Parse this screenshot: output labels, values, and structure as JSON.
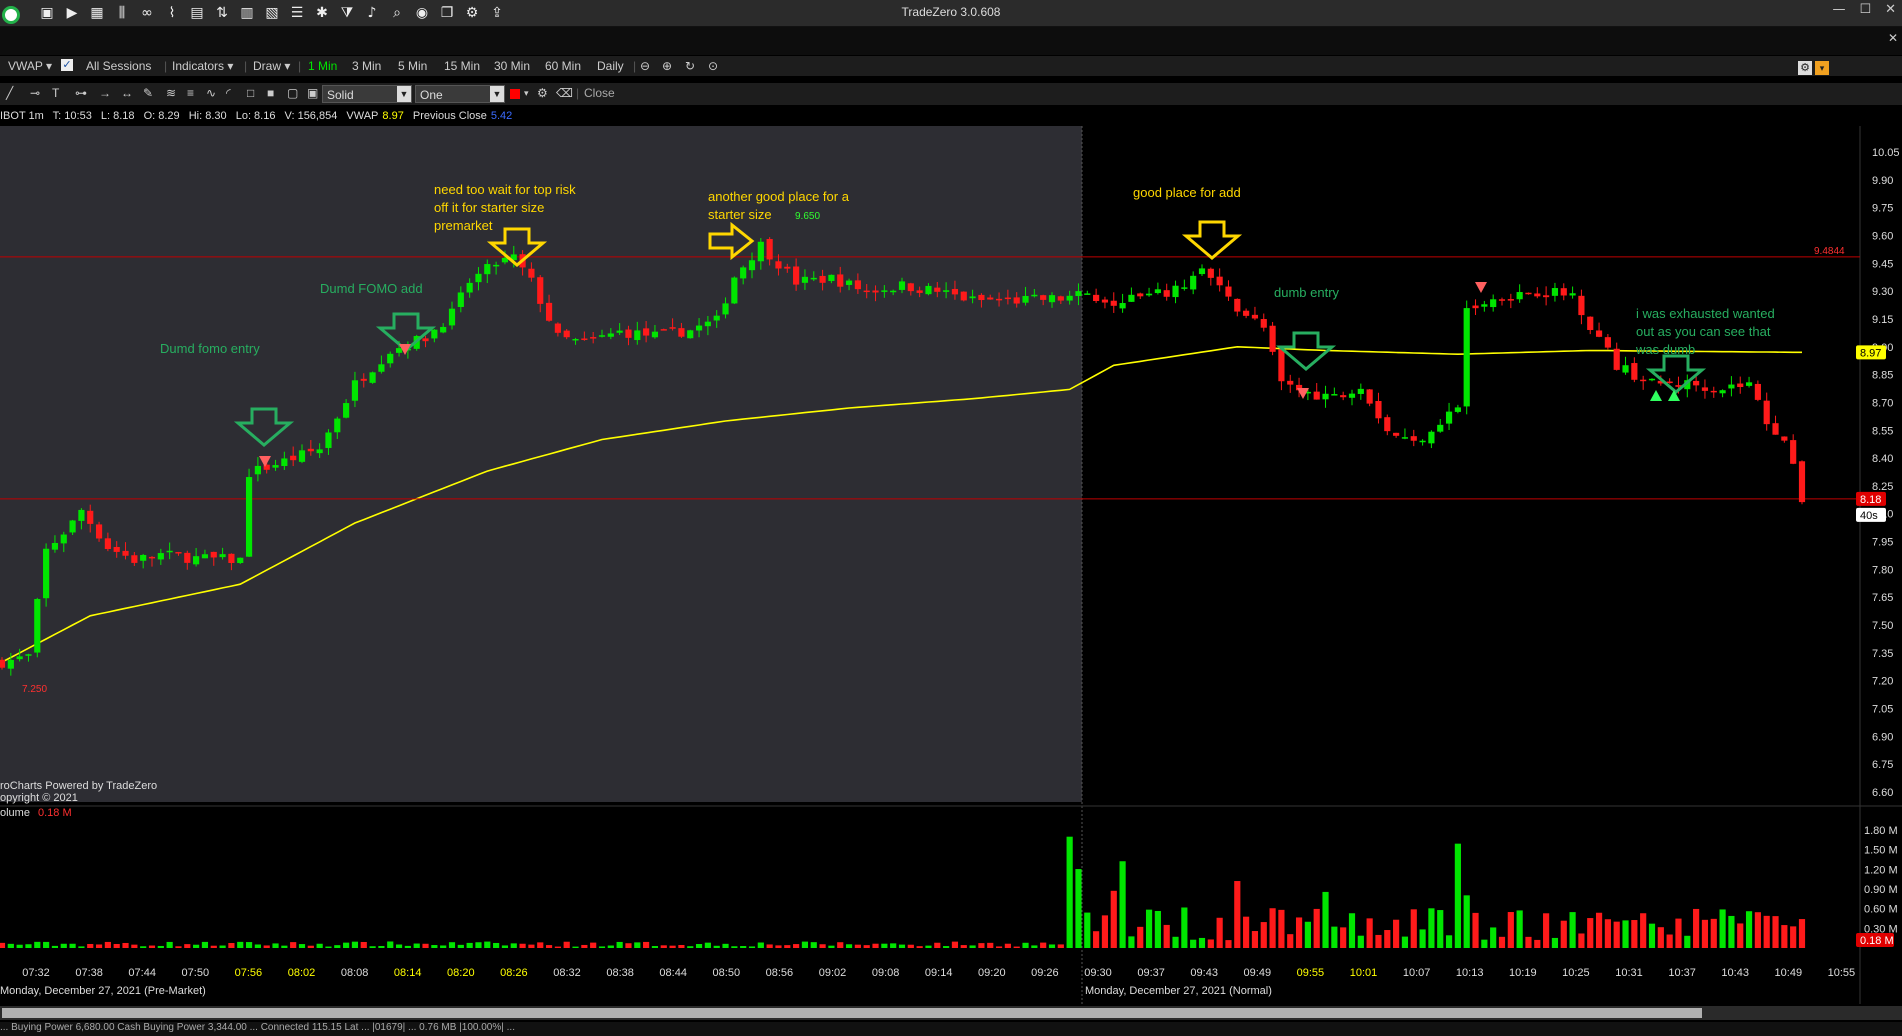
{
  "app": {
    "title": "TradeZero 3.0.608"
  },
  "toolbar_icons": [
    "camera-icon",
    "play-icon",
    "table-icon",
    "bars-icon",
    "link-icon",
    "chart-line-icon",
    "document-icon",
    "arrows-icon",
    "grid-icon",
    "news-icon",
    "list-icon",
    "tools-icon",
    "filter-icon",
    "bell-icon",
    "search-icon",
    "globe-icon",
    "windows-icon",
    "gear-icon",
    "export-icon"
  ],
  "menu": {
    "vwap": "VWAP",
    "all_sessions": "All Sessions",
    "indicators": "Indicators",
    "draw": "Draw",
    "timeframes": [
      "1 Min",
      "3 Min",
      "5 Min",
      "15 Min",
      "30 Min",
      "60 Min",
      "Daily"
    ],
    "active_timeframe": "1 Min"
  },
  "drawbar": {
    "line_style": "Solid",
    "line_width": "One",
    "close": "Close"
  },
  "info": {
    "symbol": "IBOT 1m",
    "time": "T: 10:53",
    "last": "L: 8.18",
    "open": "O: 8.29",
    "high": "Hi: 8.30",
    "low": "Lo: 8.16",
    "volume": "V: 156,854",
    "vwap_label": "VWAP",
    "vwap_value": "8.97",
    "prev_close_label": "Previous Close",
    "prev_close_value": "5.42"
  },
  "colors": {
    "up": "#00e600",
    "down": "#ff1a1a",
    "vwap": "#ffff00",
    "premarket_bg": "#2d2d33",
    "regular_bg": "#000000",
    "annotation_green": "#27ae60",
    "annotation_yellow": "#ffd700"
  },
  "watermark": {
    "line1": "roCharts Powered by TradeZero",
    "line2": "opyright © 2021"
  },
  "volume_label": "olume",
  "volume_value": "0.18 M",
  "session_labels": {
    "pre": "Monday, December 27, 2021 (Pre-Market)",
    "normal": "Monday, December 27, 2021 (Normal)"
  },
  "annotations": {
    "fomo_entry": "Dumd fomo entry",
    "fomo_add": "Dumd FOMO add",
    "wait_top_1": "need too wait for top risk",
    "wait_top_2": "off it for starter size",
    "wait_top_3": "premarket",
    "another_good_1": "another good place for a",
    "another_good_2": "starter size",
    "good_add": "good place for add",
    "dumb_entry": "dumb entry",
    "exhausted_1": "i was exhausted wanted",
    "exhausted_2": "out as you can see that",
    "exhausted_3": "was dumb"
  },
  "price_markers": {
    "low_marker": "7.250",
    "high_marker": "9.650",
    "hline_label": "9.4844",
    "vwap_tag": "8.97",
    "last_tag": "8.18",
    "timer_tag": "40s"
  },
  "status_text": "... Buying Power 6,680.00  Cash Buying Power 3,344.00  ...  Connected  115.15 Lat  ...  |01679|  ...  0.76 MB  |100.00%|  ...",
  "chart_data": {
    "type": "candlestick",
    "y_axis_ticks": [
      "10.05",
      "9.90",
      "9.75",
      "9.60",
      "9.45",
      "9.30",
      "9.15",
      "9.00",
      "8.85",
      "8.70",
      "8.55",
      "8.40",
      "8.25",
      "8.10",
      "7.95",
      "7.80",
      "7.65",
      "7.50",
      "7.35",
      "7.20",
      "7.05",
      "6.90",
      "6.75",
      "6.60"
    ],
    "ylim": [
      6.6,
      10.05
    ],
    "volume_ticks": [
      "1.80 M",
      "1.50 M",
      "1.20 M",
      "0.90 M",
      "0.60 M",
      "0.30 M"
    ],
    "volume_max": 1.8,
    "x_ticks": [
      "07:32",
      "07:38",
      "07:44",
      "07:50",
      "07:56",
      "08:02",
      "08:08",
      "08:14",
      "08:20",
      "08:26",
      "08:32",
      "08:38",
      "08:44",
      "08:50",
      "08:56",
      "09:02",
      "09:08",
      "09:14",
      "09:20",
      "09:26",
      "09:30",
      "09:37",
      "09:43",
      "09:49",
      "09:55",
      "10:01",
      "10:07",
      "10:13",
      "10:19",
      "10:25",
      "10:31",
      "10:37",
      "10:43",
      "10:49",
      "10:55"
    ],
    "highlighted_ticks": [
      "07:56",
      "08:02",
      "08:14",
      "08:20",
      "08:26",
      "09:55",
      "10:01"
    ],
    "horizontal_lines": [
      9.4844,
      8.18
    ],
    "series": [
      {
        "name": "price",
        "path": [
          [
            0,
            7.3
          ],
          [
            3,
            7.33
          ],
          [
            5,
            7.9
          ],
          [
            8,
            8.05
          ],
          [
            9,
            8.12
          ],
          [
            12,
            7.92
          ],
          [
            15,
            7.85
          ],
          [
            18,
            7.88
          ],
          [
            22,
            7.86
          ],
          [
            27,
            7.85
          ],
          [
            28,
            8.32
          ],
          [
            33,
            8.4
          ],
          [
            36,
            8.45
          ],
          [
            40,
            8.8
          ],
          [
            44,
            8.98
          ],
          [
            48,
            9.05
          ],
          [
            51,
            9.18
          ],
          [
            53,
            9.35
          ],
          [
            56,
            9.45
          ],
          [
            58,
            9.48
          ],
          [
            60,
            9.35
          ],
          [
            63,
            9.05
          ],
          [
            66,
            9.02
          ],
          [
            70,
            9.08
          ],
          [
            74,
            9.06
          ],
          [
            78,
            9.09
          ],
          [
            81,
            9.14
          ],
          [
            83,
            9.38
          ],
          [
            86,
            9.55
          ],
          [
            88,
            9.45
          ],
          [
            90,
            9.35
          ],
          [
            94,
            9.37
          ],
          [
            98,
            9.3
          ],
          [
            102,
            9.33
          ],
          [
            106,
            9.3
          ],
          [
            110,
            9.25
          ],
          [
            115,
            9.25
          ],
          [
            120,
            9.26
          ],
          [
            123,
            9.28
          ],
          [
            126,
            9.25
          ],
          [
            130,
            9.27
          ],
          [
            133,
            9.3
          ],
          [
            136,
            9.42
          ],
          [
            139,
            9.25
          ],
          [
            143,
            9.1
          ],
          [
            145,
            8.8
          ],
          [
            148,
            8.75
          ],
          [
            151,
            8.73
          ],
          [
            154,
            8.8
          ],
          [
            157,
            8.55
          ],
          [
            160,
            8.48
          ],
          [
            163,
            8.6
          ],
          [
            165,
            8.68
          ],
          [
            166,
            9.2
          ],
          [
            170,
            9.27
          ],
          [
            174,
            9.3
          ],
          [
            178,
            9.28
          ],
          [
            180,
            9.12
          ],
          [
            183,
            8.9
          ],
          [
            187,
            8.8
          ],
          [
            191,
            8.8
          ],
          [
            195,
            8.78
          ],
          [
            198,
            8.8
          ],
          [
            200,
            8.6
          ],
          [
            202,
            8.5
          ],
          [
            204,
            8.18
          ]
        ]
      },
      {
        "name": "VWAP",
        "path": [
          [
            0,
            7.3
          ],
          [
            10,
            7.55
          ],
          [
            27,
            7.72
          ],
          [
            40,
            8.05
          ],
          [
            55,
            8.33
          ],
          [
            68,
            8.5
          ],
          [
            82,
            8.6
          ],
          [
            96,
            8.67
          ],
          [
            110,
            8.72
          ],
          [
            121,
            8.77
          ],
          [
            126,
            8.9
          ],
          [
            140,
            9.0
          ],
          [
            150,
            8.98
          ],
          [
            165,
            8.96
          ],
          [
            180,
            8.98
          ],
          [
            204,
            8.97
          ]
        ]
      }
    ],
    "session_split_index": 121
  }
}
